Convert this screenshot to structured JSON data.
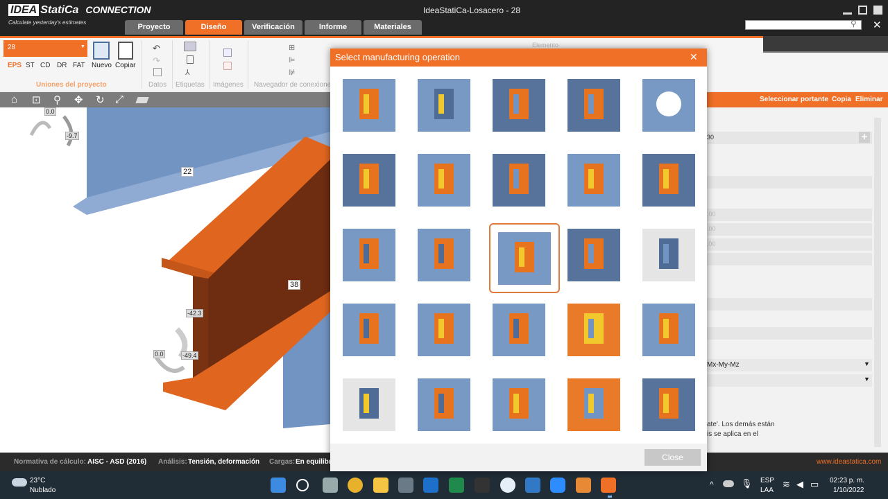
{
  "app": {
    "logo": "IDEA",
    "logo_suffix": "StatiCa",
    "product": "CONNECTION",
    "tagline": "Calculate yesterday's estimates",
    "window_title": "IdeaStatiCa-Losacero - 28"
  },
  "menu_tabs": [
    "Proyecto",
    "Diseño",
    "Verificación",
    "Informe",
    "Materiales"
  ],
  "ribbon": {
    "combo_value": "28",
    "filter_tabs": [
      "EPS",
      "ST",
      "CD",
      "DR",
      "FAT"
    ],
    "new_label": "Nuevo",
    "copy_label": "Copiar",
    "group_uniones": "Uniones del proyecto",
    "group_datos": "Datos",
    "group_etiquetas": "Etiquetas",
    "group_imagenes": "Imágenes",
    "group_navegador": "Navegador de conexione",
    "elemento": "Elemento"
  },
  "viewport": {
    "labels": {
      "a": "22",
      "b": "38"
    },
    "numbers": {
      "n1": "0.0",
      "n2": "-9.7",
      "n3": "-42.3",
      "n4": "0.0",
      "n5": "-49.4"
    }
  },
  "right_panel": {
    "links": [
      "Seleccionar portante",
      "Copia",
      "Eliminar"
    ],
    "row1": "30",
    "rows": [
      ".00",
      ".00",
      ".00"
    ],
    "dd1": "Mx-My-Mz",
    "note1": "ate'. Los demás están",
    "note2": "is se aplica en el"
  },
  "modal": {
    "title": "Select manufacturing operation",
    "close_label": "Close",
    "selected_index": 12,
    "operations": [
      "stiffener-plate-icon",
      "web-stiffener-icon",
      "rib-plate-icon",
      "base-plate-stiffener-icon",
      "plate-opening-icon",
      "end-plate-icon",
      "fin-plate-icon",
      "double-plate-icon",
      "flange-plate-icon",
      "bolted-flange-plate-icon",
      "gusset-plate-icon",
      "cone-plate-icon",
      "bolted-end-plate-icon",
      "column-splice-icon",
      "anchor-base-icon",
      "mitre-cut-icon",
      "plate-icon",
      "cleat-icon",
      "gusset-bolts-icon",
      "cover-plate-icon",
      "weld-icon",
      "hollow-section-icon",
      "cut-member-icon",
      "truss-node-icon",
      "beam-splice-icon"
    ]
  },
  "status_bar": {
    "norm_label": "Normativa de cálculo:",
    "norm_value": "AISC - ASD (2016)",
    "analysis_label": "Análisis:",
    "analysis_value": "Tensión, deformación",
    "loads_label": "Cargas:",
    "loads_value": "En equilibr",
    "url": "www.ideastatica.com"
  },
  "taskbar": {
    "temp": "23°C",
    "weather": "Nublado",
    "lang1": "ESP",
    "lang2": "LAA",
    "time": "02:23 p. m.",
    "date": "1/10/2022"
  },
  "colors": {
    "accent": "#f07028",
    "steel": "#7294c2",
    "dark": "#232323"
  }
}
